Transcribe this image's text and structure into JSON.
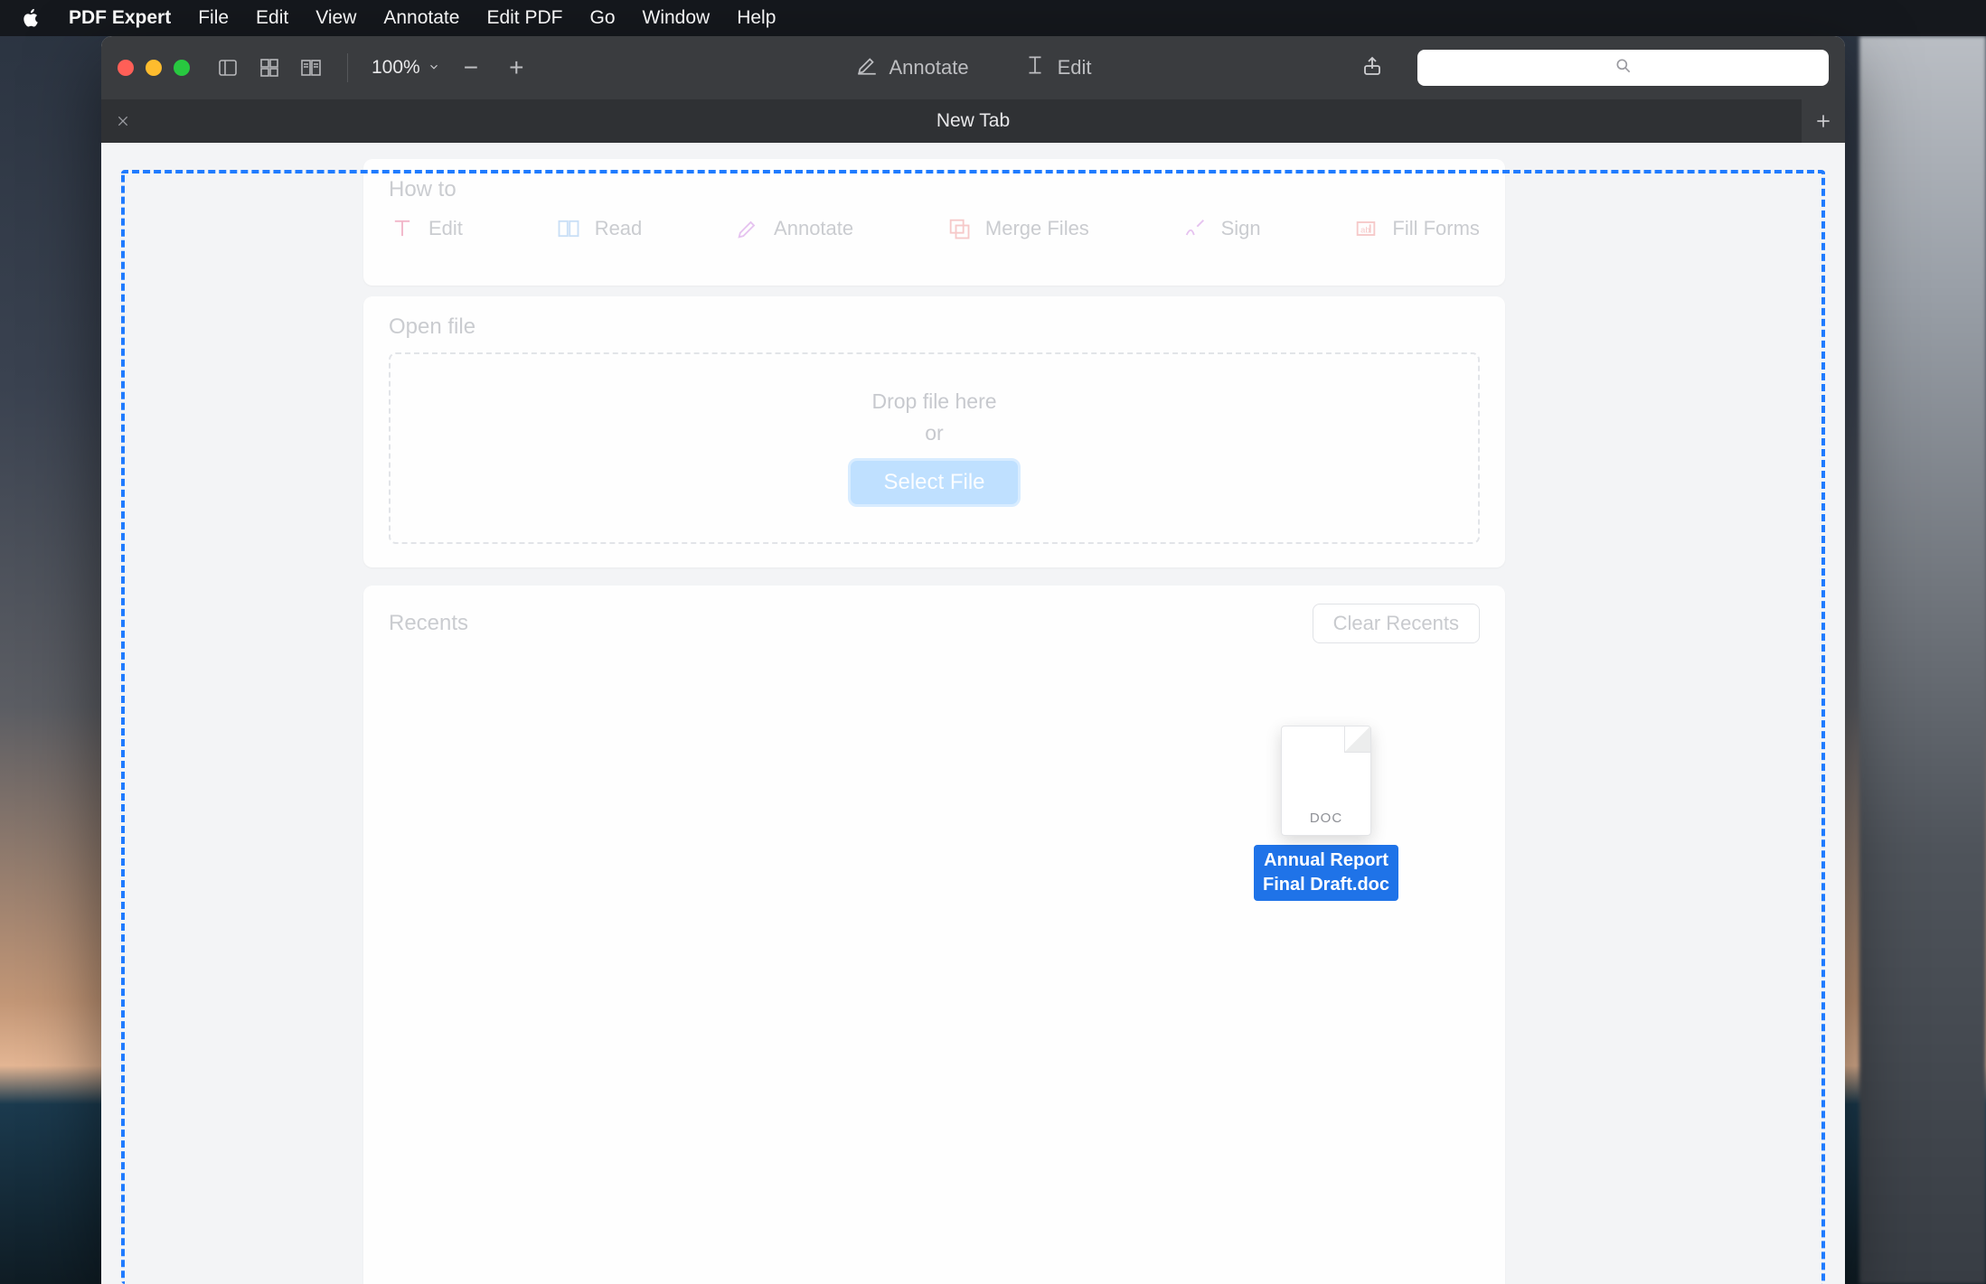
{
  "menubar": {
    "app": "PDF Expert",
    "items": [
      "File",
      "Edit",
      "View",
      "Annotate",
      "Edit PDF",
      "Go",
      "Window",
      "Help"
    ]
  },
  "toolbar": {
    "zoom": "100%",
    "annotate": "Annotate",
    "edit": "Edit"
  },
  "tab": {
    "title": "New Tab"
  },
  "howto": {
    "title": "How to",
    "items": [
      "Edit",
      "Read",
      "Annotate",
      "Merge Files",
      "Sign",
      "Fill Forms"
    ]
  },
  "openfile": {
    "title": "Open file",
    "drop_line": "Drop file here",
    "or": "or",
    "select": "Select File"
  },
  "recents": {
    "title": "Recents",
    "clear": "Clear Recents"
  },
  "dragged": {
    "ext": "DOC",
    "name_l1": "Annual Report",
    "name_l2": "Final Draft.doc"
  }
}
